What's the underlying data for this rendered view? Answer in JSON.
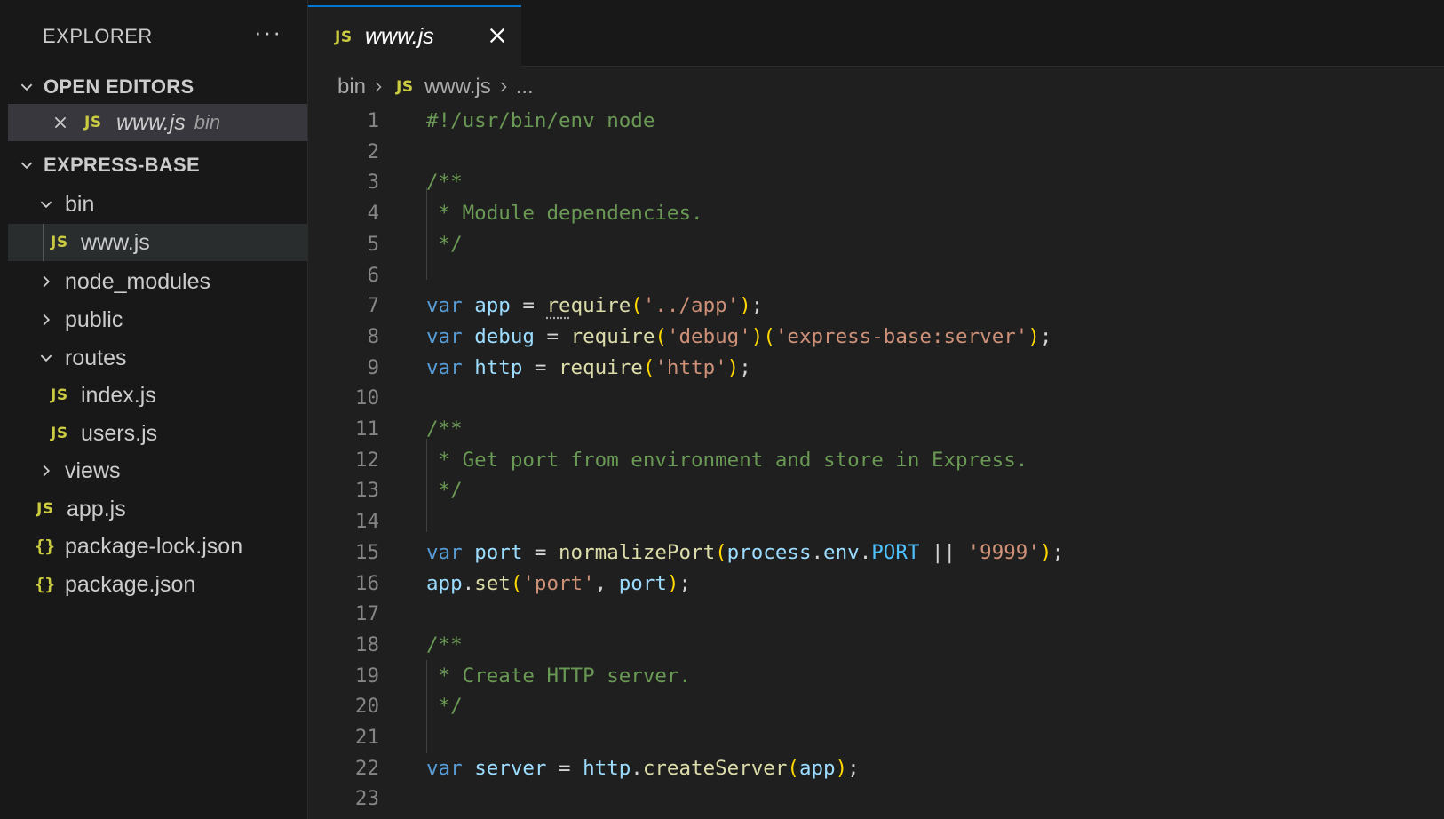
{
  "sidebar": {
    "title": "EXPLORER",
    "more_label": "···",
    "open_editors": {
      "title": "OPEN EDITORS",
      "items": [
        {
          "badge": "JS",
          "name": "www.js",
          "hint": "bin"
        }
      ]
    },
    "project": {
      "title": "EXPRESS-BASE",
      "items": [
        {
          "type": "folder",
          "name": "bin",
          "expanded": true
        },
        {
          "type": "js",
          "badge": "JS",
          "name": "www.js"
        },
        {
          "type": "folder",
          "name": "node_modules",
          "expanded": false
        },
        {
          "type": "folder",
          "name": "public",
          "expanded": false
        },
        {
          "type": "folder",
          "name": "routes",
          "expanded": true
        },
        {
          "type": "js",
          "badge": "JS",
          "name": "index.js"
        },
        {
          "type": "js",
          "badge": "JS",
          "name": "users.js"
        },
        {
          "type": "folder",
          "name": "views",
          "expanded": false
        },
        {
          "type": "js",
          "badge": "JS",
          "name": "app.js"
        },
        {
          "type": "json",
          "badge": "{}",
          "name": "package-lock.json"
        },
        {
          "type": "json",
          "badge": "{}",
          "name": "package.json"
        }
      ]
    }
  },
  "editor": {
    "tab": {
      "badge": "JS",
      "title": "www.js"
    },
    "breadcrumbs": {
      "folder": "bin",
      "badge": "JS",
      "file": "www.js",
      "more": "..."
    },
    "lines": [
      {
        "n": "1",
        "segs": [
          [
            "c-cmt",
            "#!/usr/bin/env node"
          ]
        ]
      },
      {
        "n": "2",
        "segs": []
      },
      {
        "n": "3",
        "segs": [
          [
            "c-cmt",
            "/**"
          ]
        ]
      },
      {
        "n": "4",
        "segs": [
          [
            "c-cmt",
            " * Module dependencies."
          ]
        ]
      },
      {
        "n": "5",
        "segs": [
          [
            "c-cmt",
            " */"
          ]
        ]
      },
      {
        "n": "6",
        "segs": []
      },
      {
        "n": "7",
        "segs": [
          [
            "c-kw",
            "var"
          ],
          [
            "c-pun",
            " "
          ],
          [
            "c-var",
            "app"
          ],
          [
            "c-pun",
            " = "
          ],
          [
            "c-fn dots",
            "re"
          ],
          [
            "c-fn",
            "quire"
          ],
          [
            "c-br1",
            "("
          ],
          [
            "c-str",
            "'../app'"
          ],
          [
            "c-br1",
            ")"
          ],
          [
            "c-pun",
            ";"
          ]
        ]
      },
      {
        "n": "8",
        "segs": [
          [
            "c-kw",
            "var"
          ],
          [
            "c-pun",
            " "
          ],
          [
            "c-var",
            "debug"
          ],
          [
            "c-pun",
            " = "
          ],
          [
            "c-fn",
            "require"
          ],
          [
            "c-br1",
            "("
          ],
          [
            "c-str",
            "'debug'"
          ],
          [
            "c-br1",
            ")"
          ],
          [
            "c-br1",
            "("
          ],
          [
            "c-str",
            "'express-base:server'"
          ],
          [
            "c-br1",
            ")"
          ],
          [
            "c-pun",
            ";"
          ]
        ]
      },
      {
        "n": "9",
        "segs": [
          [
            "c-kw",
            "var"
          ],
          [
            "c-pun",
            " "
          ],
          [
            "c-var",
            "http"
          ],
          [
            "c-pun",
            " = "
          ],
          [
            "c-fn",
            "require"
          ],
          [
            "c-br1",
            "("
          ],
          [
            "c-str",
            "'http'"
          ],
          [
            "c-br1",
            ")"
          ],
          [
            "c-pun",
            ";"
          ]
        ]
      },
      {
        "n": "10",
        "segs": []
      },
      {
        "n": "11",
        "segs": [
          [
            "c-cmt",
            "/**"
          ]
        ]
      },
      {
        "n": "12",
        "segs": [
          [
            "c-cmt",
            " * Get port from environment and store in Express."
          ]
        ]
      },
      {
        "n": "13",
        "segs": [
          [
            "c-cmt",
            " */"
          ]
        ]
      },
      {
        "n": "14",
        "segs": []
      },
      {
        "n": "15",
        "segs": [
          [
            "c-kw",
            "var"
          ],
          [
            "c-pun",
            " "
          ],
          [
            "c-var",
            "port"
          ],
          [
            "c-pun",
            " = "
          ],
          [
            "c-fn",
            "normalizePort"
          ],
          [
            "c-br1",
            "("
          ],
          [
            "c-var",
            "process"
          ],
          [
            "c-pun",
            "."
          ],
          [
            "c-var",
            "env"
          ],
          [
            "c-pun",
            "."
          ],
          [
            "c-const",
            "PORT"
          ],
          [
            "c-pun",
            " || "
          ],
          [
            "c-str",
            "'9999'"
          ],
          [
            "c-br1",
            ")"
          ],
          [
            "c-pun",
            ";"
          ]
        ]
      },
      {
        "n": "16",
        "segs": [
          [
            "c-var",
            "app"
          ],
          [
            "c-pun",
            "."
          ],
          [
            "c-fn",
            "set"
          ],
          [
            "c-br1",
            "("
          ],
          [
            "c-str",
            "'port'"
          ],
          [
            "c-pun",
            ", "
          ],
          [
            "c-var",
            "port"
          ],
          [
            "c-br1",
            ")"
          ],
          [
            "c-pun",
            ";"
          ]
        ]
      },
      {
        "n": "17",
        "segs": []
      },
      {
        "n": "18",
        "segs": [
          [
            "c-cmt",
            "/**"
          ]
        ]
      },
      {
        "n": "19",
        "segs": [
          [
            "c-cmt",
            " * Create HTTP server."
          ]
        ]
      },
      {
        "n": "20",
        "segs": [
          [
            "c-cmt",
            " */"
          ]
        ]
      },
      {
        "n": "21",
        "segs": []
      },
      {
        "n": "22",
        "segs": [
          [
            "c-kw",
            "var"
          ],
          [
            "c-pun",
            " "
          ],
          [
            "c-var",
            "server"
          ],
          [
            "c-pun",
            " = "
          ],
          [
            "c-var",
            "http"
          ],
          [
            "c-pun",
            "."
          ],
          [
            "c-fn",
            "createServer"
          ],
          [
            "c-br1",
            "("
          ],
          [
            "c-var",
            "app"
          ],
          [
            "c-br1",
            ")"
          ],
          [
            "c-pun",
            ";"
          ]
        ]
      },
      {
        "n": "23",
        "segs": []
      }
    ]
  }
}
